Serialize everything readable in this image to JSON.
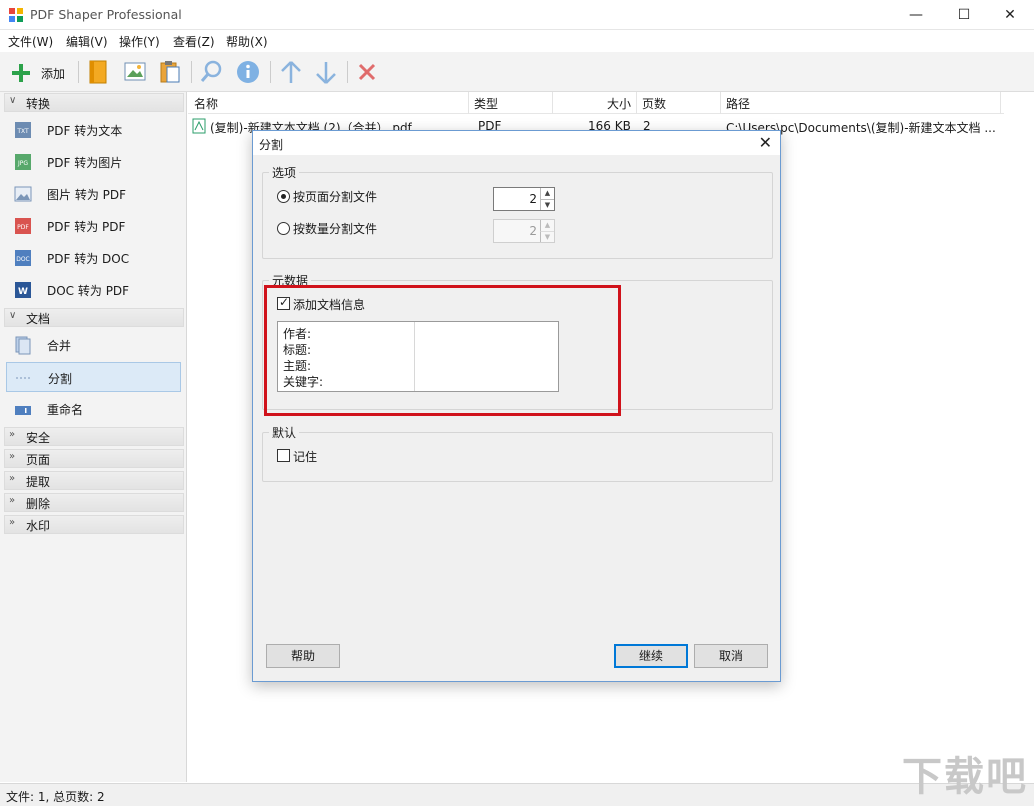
{
  "window": {
    "title": "PDF Shaper Professional"
  },
  "menu": [
    "文件(W)",
    "编辑(V)",
    "操作(Y)",
    "查看(Z)",
    "帮助(X)"
  ],
  "toolbar": {
    "add_label": "添加"
  },
  "sidebar": {
    "convert": {
      "title": "转换",
      "items": [
        "PDF 转为文本",
        "PDF 转为图片",
        "图片 转为 PDF",
        "PDF 转为 PDF",
        "PDF 转为 DOC",
        "DOC 转为 PDF"
      ],
      "icon_tags": [
        "TXT",
        "JPG",
        "",
        "PDF",
        "DOC",
        "W"
      ]
    },
    "document": {
      "title": "文档",
      "items": [
        "合并",
        "分割",
        "重命名"
      ]
    },
    "collapsed": [
      "安全",
      "页面",
      "提取",
      "删除",
      "水印"
    ]
  },
  "list": {
    "columns": [
      "名称",
      "类型",
      "大小",
      "页数",
      "路径"
    ],
    "rows": [
      {
        "name": "(复制)-新建文本文档 (2)（合并）.pdf",
        "type": "PDF",
        "size": "166 KB",
        "pages": "2",
        "path": "C:\\Users\\pc\\Documents\\(复制)-新建文本文档 ..."
      }
    ]
  },
  "status": {
    "text": "文件: 1, 总页数: 2"
  },
  "dialog": {
    "title": "分割",
    "options_title": "选项",
    "radio_by_pages": "按页面分割文件",
    "radio_by_count": "按数量分割文件",
    "pages_value": "2",
    "count_value": "2",
    "metadata_title": "元数据",
    "add_info_label": "添加文档信息",
    "meta_keys": [
      "作者:",
      "标题:",
      "主题:",
      "关键字:"
    ],
    "default_title": "默认",
    "remember_label": "记住",
    "help_button": "帮助",
    "continue_button": "继续",
    "cancel_button": "取消"
  },
  "watermark": "下载吧"
}
